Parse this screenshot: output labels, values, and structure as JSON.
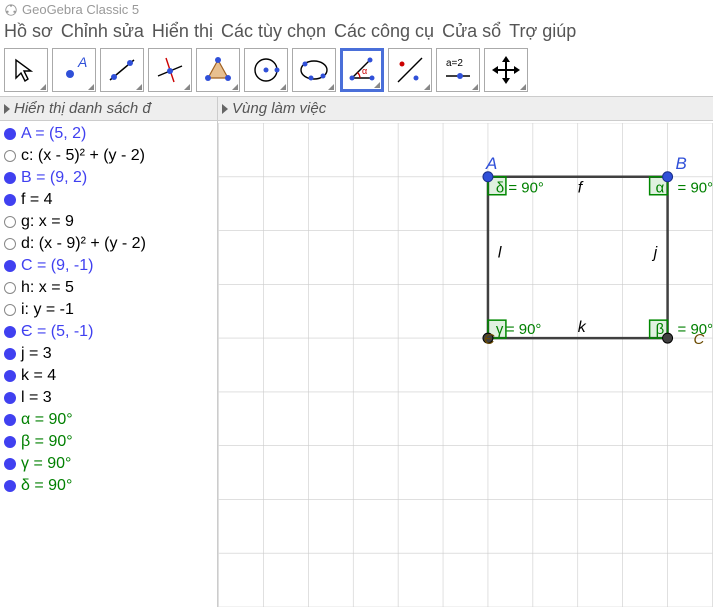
{
  "app_title": "GeoGebra Classic 5",
  "menus": [
    "Hồ sơ",
    "Chỉnh sửa",
    "Hiển thị",
    "Các tùy chọn",
    "Các công cụ",
    "Cửa sổ",
    "Trợ giúp"
  ],
  "toolbar_tools": [
    "move",
    "point",
    "line",
    "line-through",
    "polygon",
    "circle",
    "conic",
    "angle",
    "reflect",
    "slider",
    "move-view"
  ],
  "toolbar_selected_index": 7,
  "left_panel_title": "Hiển thị danh sách đ",
  "right_panel_title": "Vùng làm việc",
  "algebra": [
    {
      "kind": "point",
      "bullet": "filled",
      "text": "A = (5, 2)"
    },
    {
      "kind": "obj",
      "bullet": "hollow",
      "text": "c: (x - 5)² + (y - 2)"
    },
    {
      "kind": "point",
      "bullet": "filled",
      "text": "B = (9, 2)"
    },
    {
      "kind": "obj",
      "bullet": "filled",
      "text": "f = 4"
    },
    {
      "kind": "obj",
      "bullet": "hollow",
      "text": "g: x = 9"
    },
    {
      "kind": "obj",
      "bullet": "hollow",
      "text": "d: (x - 9)² + (y - 2)"
    },
    {
      "kind": "point",
      "bullet": "filled",
      "text": "C = (9, -1)"
    },
    {
      "kind": "obj",
      "bullet": "hollow",
      "text": "h: x = 5"
    },
    {
      "kind": "obj",
      "bullet": "hollow",
      "text": "i: y = -1"
    },
    {
      "kind": "point",
      "bullet": "filled",
      "text": "Є = (5, -1)"
    },
    {
      "kind": "obj",
      "bullet": "filled",
      "text": "j = 3"
    },
    {
      "kind": "obj",
      "bullet": "filled",
      "text": "k = 4"
    },
    {
      "kind": "obj",
      "bullet": "filled",
      "text": "l = 3"
    },
    {
      "kind": "angle",
      "bullet": "filled",
      "text": "α = 90°"
    },
    {
      "kind": "angle",
      "bullet": "filled",
      "text": "β = 90°"
    },
    {
      "kind": "angle",
      "bullet": "filled",
      "text": "γ = 90°"
    },
    {
      "kind": "angle",
      "bullet": "filled",
      "text": "δ = 90°"
    }
  ],
  "chart_data": {
    "type": "table",
    "description": "Rectangle drawn in graphics view with four right angles",
    "points": [
      {
        "name": "A",
        "x": 5,
        "y": 2
      },
      {
        "name": "B",
        "x": 9,
        "y": 2
      },
      {
        "name": "C",
        "x": 9,
        "y": -1
      },
      {
        "name": "Є",
        "x": 5,
        "y": -1
      }
    ],
    "segments": [
      {
        "name": "f",
        "from": "A",
        "to": "B",
        "length": 4
      },
      {
        "name": "j",
        "from": "B",
        "to": "C",
        "length": 3
      },
      {
        "name": "k",
        "from": "C",
        "to": "Є",
        "length": 4
      },
      {
        "name": "l",
        "from": "Є",
        "to": "A",
        "length": 3
      }
    ],
    "angles": [
      {
        "name": "δ",
        "at": "A",
        "value": 90
      },
      {
        "name": "α",
        "at": "B",
        "value": 90
      },
      {
        "name": "β",
        "at": "C",
        "value": 90
      },
      {
        "name": "γ",
        "at": "Є",
        "value": 90
      }
    ],
    "view_x_range": [
      -1,
      10
    ],
    "view_y_range": [
      -6,
      3
    ],
    "grid_step": 1
  },
  "graphics_labels": {
    "A": "A",
    "B": "B",
    "E": "Є",
    "C": "C",
    "f": "f",
    "j": "j",
    "k": "k",
    "l": "l",
    "delta": "δ = 90°",
    "alpha": "α",
    "alpha_v": "= 90°",
    "gamma": "γ",
    "gamma_v": "= 90°",
    "beta": "β",
    "beta_v": "= 90°"
  }
}
